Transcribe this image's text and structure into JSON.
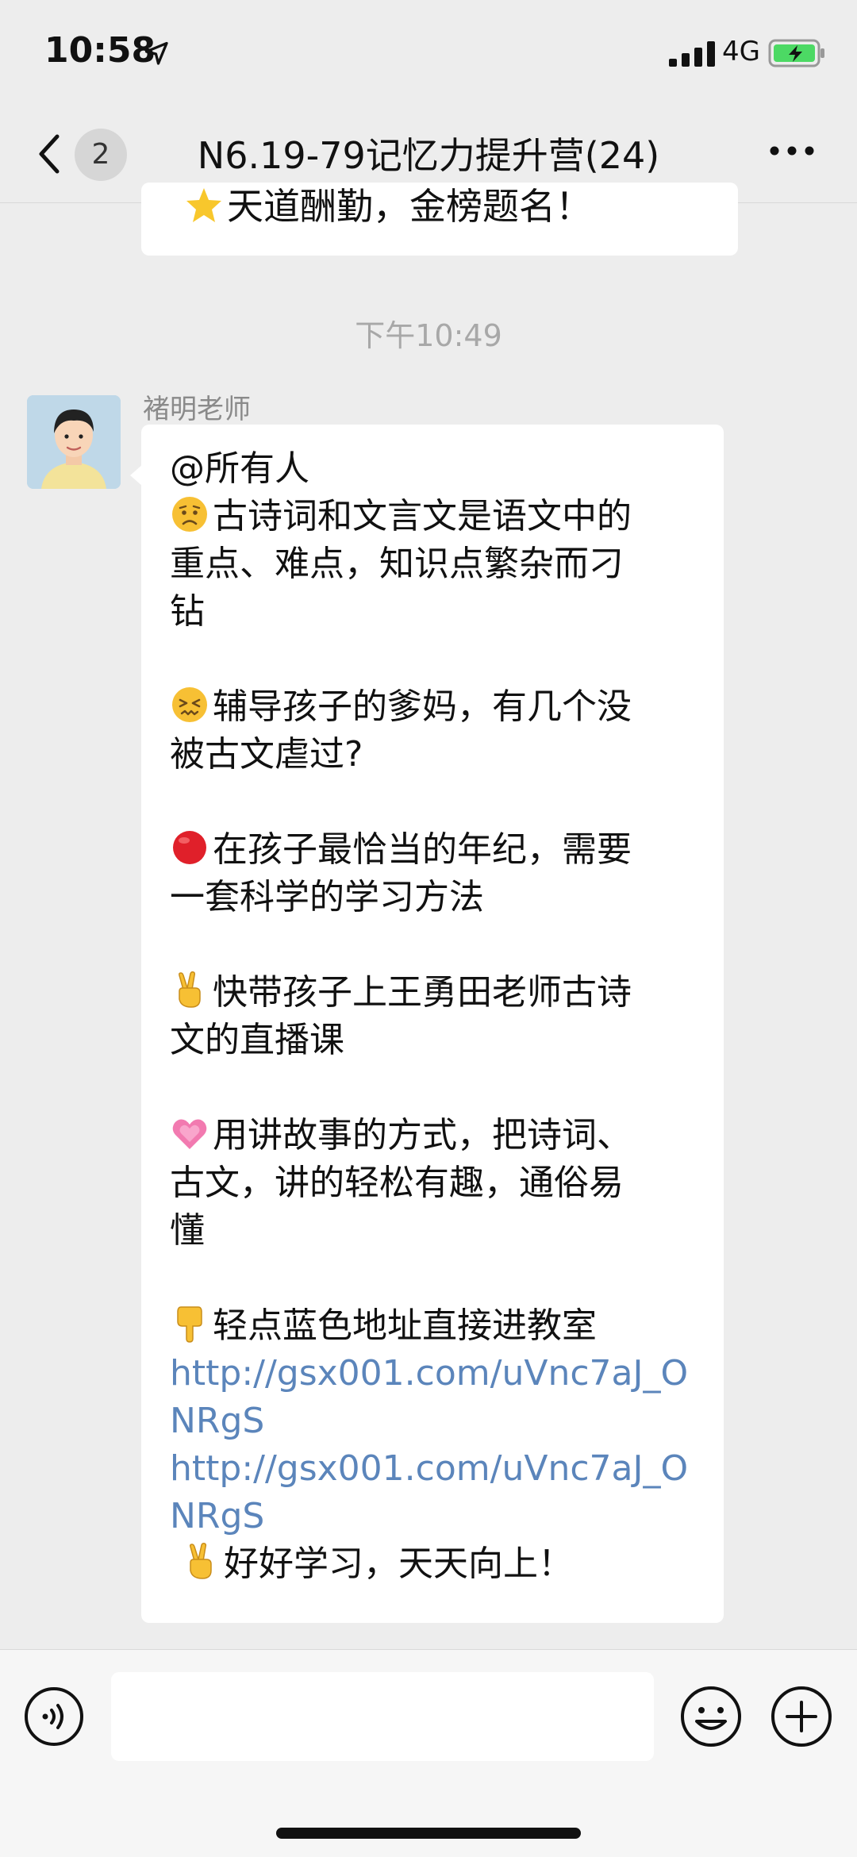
{
  "status_bar": {
    "time": "10:58",
    "network": "4G",
    "icons": [
      "location-arrow-icon",
      "signal-bars-icon",
      "battery-charging-icon"
    ]
  },
  "nav": {
    "back_icon": "chevron-left-icon",
    "unread_count": "2",
    "title": "N6.19-79记忆力提升营(24)",
    "more_icon": "ellipsis-icon"
  },
  "previous_message": {
    "emoji": "star-icon",
    "text": "天道酬勤，金榜题名！"
  },
  "timestamp": "下午10:49",
  "message": {
    "sender": "褚明老师",
    "lines": {
      "mention": "@所有人",
      "p1_l1": "古诗词和文言文是语文中的",
      "p1_l2": "重点、难点，知识点繁杂而刁",
      "p1_l3": "钻",
      "p2_l1": "辅导孩子的爹妈，有几个没",
      "p2_l2": "被古文虐过?",
      "p3_l1": "在孩子最恰当的年纪，需要",
      "p3_l2": "一套科学的学习方法",
      "p4_l1": "快带孩子上王勇田老师古诗",
      "p4_l2": "文的直播课",
      "p5_l1": "用讲故事的方式，把诗词、",
      "p5_l2": "古文，讲的轻松有趣，通俗易",
      "p5_l3": "懂",
      "p6_l1": "轻点蓝色地址直接进教室",
      "link1_l1": "http://gsx001.com/uVnc7aJ_O",
      "link1_l2": "NRgS",
      "link2_l1": "http://gsx001.com/uVnc7aJ_O",
      "link2_l2": "NRgS",
      "closing": "好好学习，天天向上！"
    },
    "emoji_icons": [
      "worried-face-icon",
      "confounded-face-icon",
      "red-circle-icon",
      "victory-hand-icon",
      "growing-heart-icon",
      "pointing-down-icon",
      "victory-hand-icon"
    ]
  },
  "input_bar": {
    "voice_icon": "voice-icon",
    "input_value": "",
    "emoji_icon": "smiley-face-icon",
    "plus_icon": "plus-circle-icon"
  },
  "colors": {
    "background": "#ededed",
    "bubble": "#ffffff",
    "link": "#5b85bb",
    "timestamp": "#a8a8a8"
  }
}
